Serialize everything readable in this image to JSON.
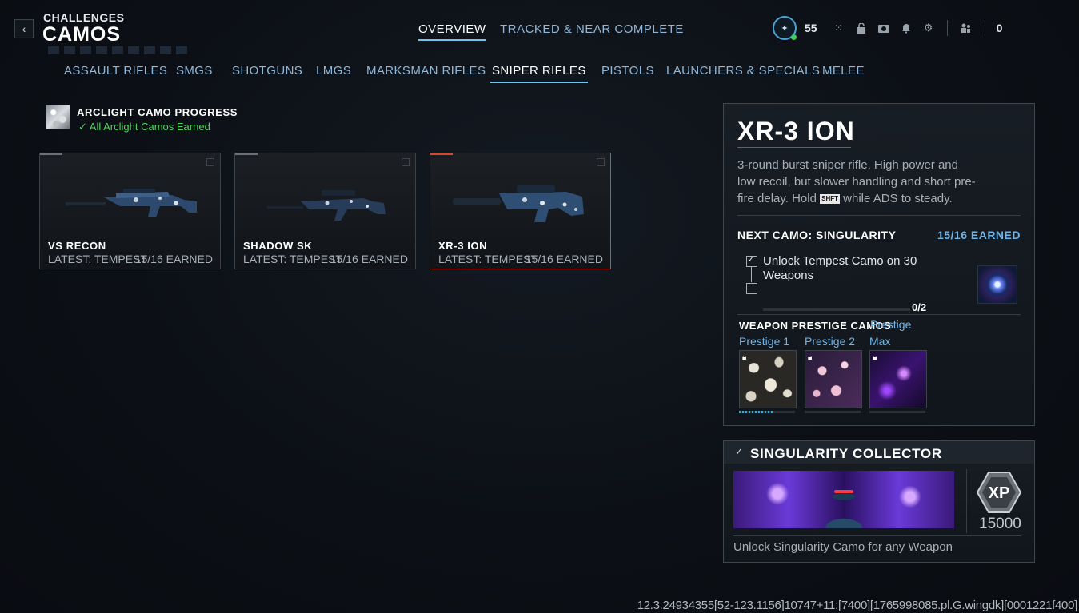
{
  "header": {
    "back_icon": "chevron-left-icon",
    "section": "CHALLENGES",
    "title": "CAMOS"
  },
  "top_tabs": [
    {
      "label": "OVERVIEW",
      "active": true
    },
    {
      "label": "TRACKED & NEAR COMPLETE",
      "active": false
    }
  ],
  "status": {
    "level": "55",
    "currency": "0",
    "icons": [
      "grid-icon",
      "lock-icon",
      "camera-icon",
      "bell-icon",
      "gear-icon",
      "party-icon"
    ]
  },
  "categories": [
    {
      "label": "ASSAULT RIFLES",
      "active": false
    },
    {
      "label": "SMGS",
      "active": false
    },
    {
      "label": "SHOTGUNS",
      "active": false
    },
    {
      "label": "LMGS",
      "active": false
    },
    {
      "label": "MARKSMAN RIFLES",
      "active": false
    },
    {
      "label": "SNIPER RIFLES",
      "active": true
    },
    {
      "label": "PISTOLS",
      "active": false
    },
    {
      "label": "LAUNCHERS & SPECIALS",
      "active": false
    },
    {
      "label": "MELEE",
      "active": false
    }
  ],
  "arclight": {
    "title": "ARCLIGHT CAMO PROGRESS",
    "status": "All Arclight Camos Earned",
    "status_icon": "check-icon",
    "status_color": "#4fd15f"
  },
  "weapons": [
    {
      "name": "VS RECON",
      "latest": "LATEST: TEMPEST",
      "earned": "15/16 EARNED",
      "selected": false
    },
    {
      "name": "SHADOW SK",
      "latest": "LATEST: TEMPEST",
      "earned": "15/16 EARNED",
      "selected": false
    },
    {
      "name": "XR-3 ION",
      "latest": "LATEST: TEMPEST",
      "earned": "15/16 EARNED",
      "selected": true
    }
  ],
  "detail": {
    "title": "XR-3 ION",
    "desc_before_key": "3-round burst sniper rifle. High power and low recoil, but slower handling and short pre-fire delay. Hold ",
    "key": "SHFT",
    "desc_after_key": " while ADS to steady.",
    "next_camo_label": "NEXT CAMO: SINGULARITY",
    "next_camo_earned": "15/16 EARNED",
    "task": "Unlock Tempest Camo on 30 Weapons",
    "task_progress": "0/2",
    "task_progress_fraction": 0,
    "prestige_label": "WEAPON PRESTIGE CAMOS",
    "prestige_overlay": "Prestige",
    "prestige": [
      {
        "label": "Prestige 1",
        "progress_fraction": 0.6
      },
      {
        "label": "Prestige 2",
        "progress_fraction": 0
      },
      {
        "label": "Max",
        "progress_fraction": 0
      }
    ]
  },
  "collector": {
    "title": "SINGULARITY COLLECTOR",
    "xp_label": "XP",
    "xp_value": "15000",
    "desc": "Unlock Singularity Camo for any Weapon"
  },
  "build_string": "12.3.24934355[52-123.1156]10747+11:[7400][1765998085.pl.G.wingdk][0001221f400]",
  "colors": {
    "accent_blue": "#6ec6f0",
    "tab_text": "#8fb7d9",
    "selected_border": "#d9482d"
  }
}
